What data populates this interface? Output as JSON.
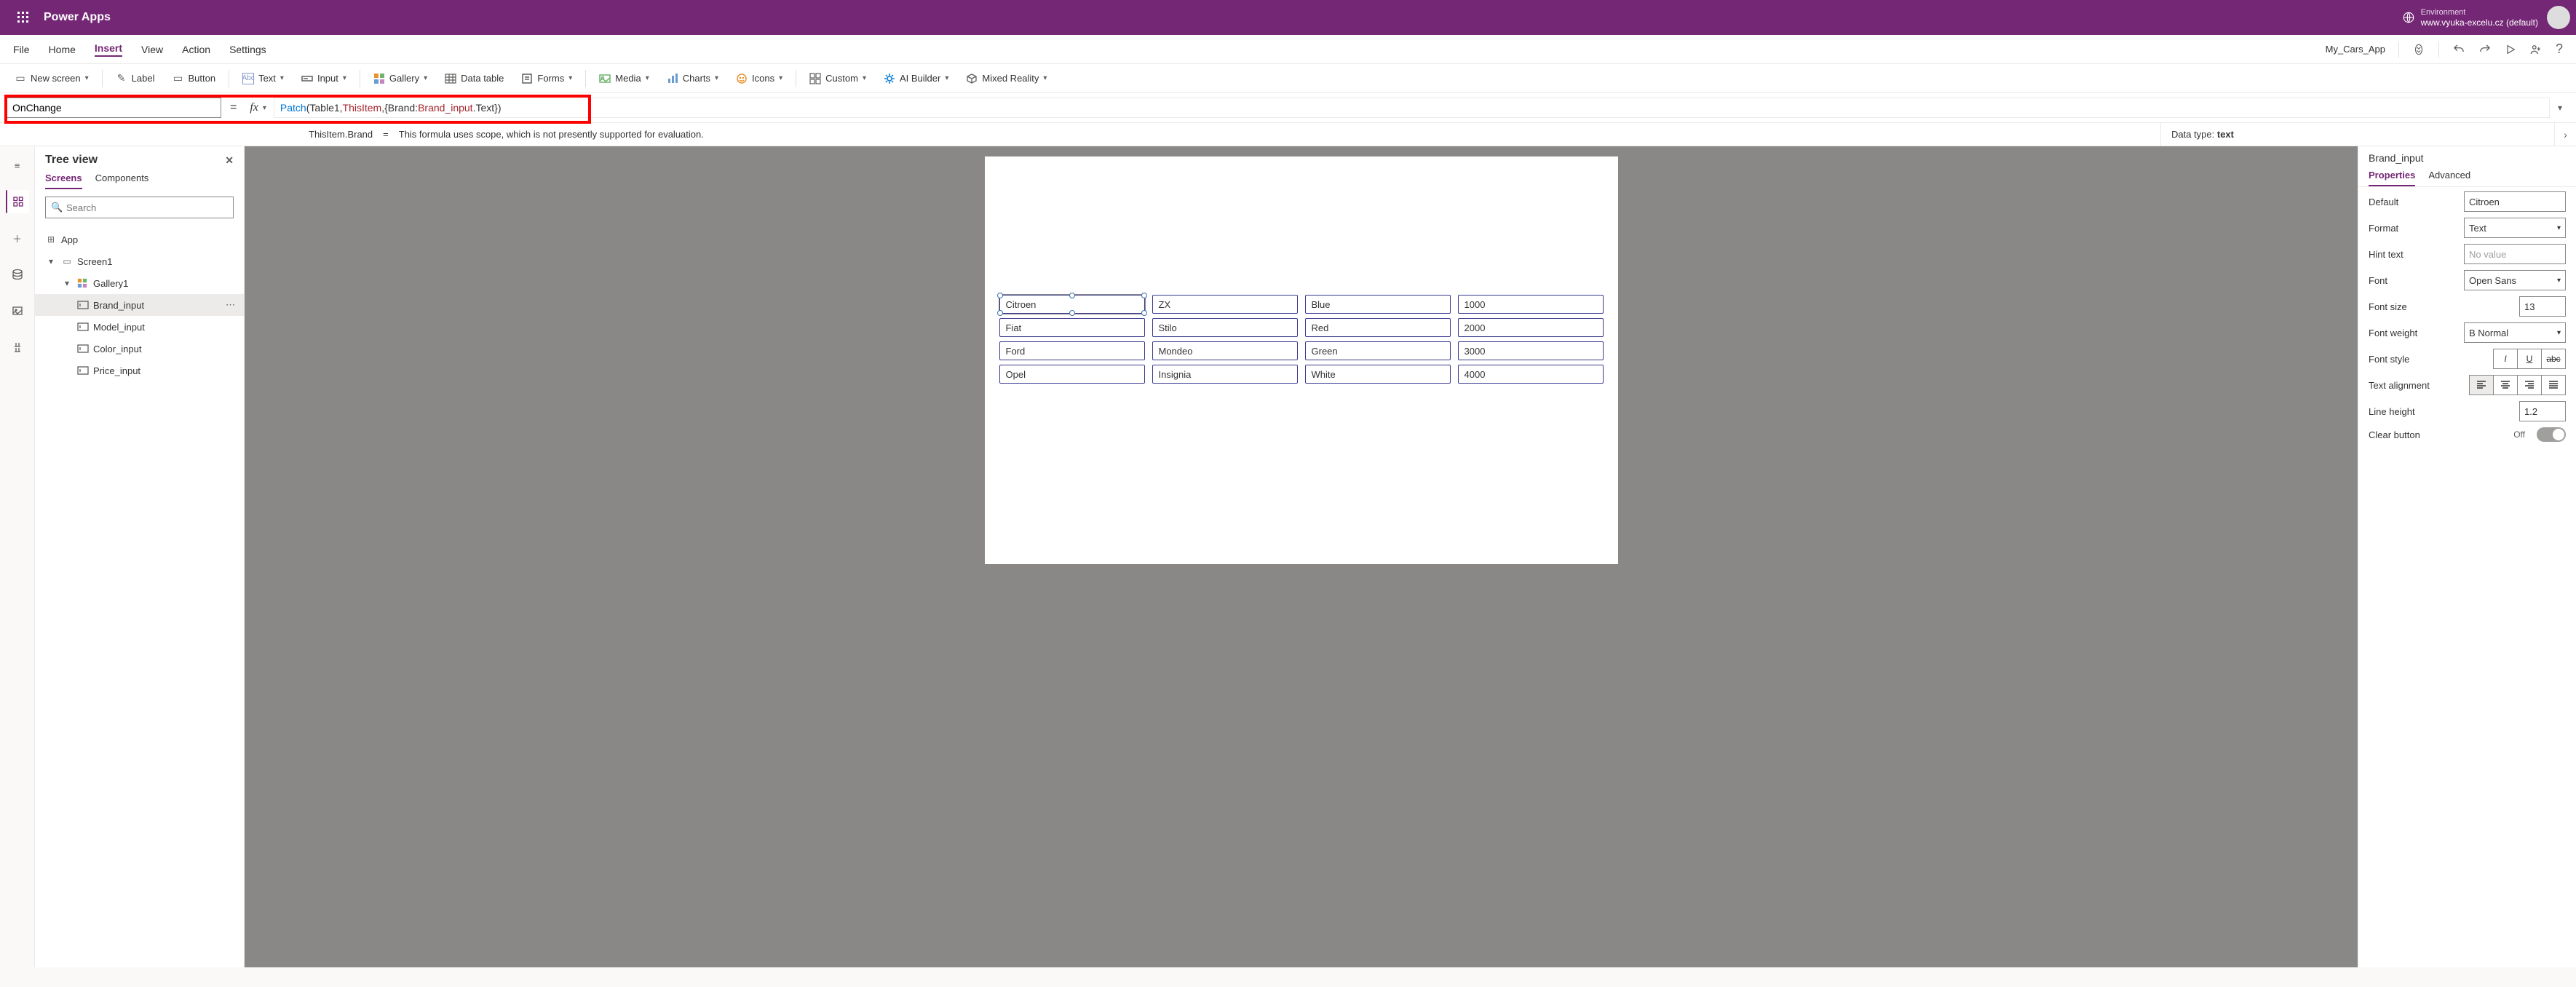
{
  "header": {
    "app_title": "Power Apps",
    "env_label": "Environment",
    "env_name": "www.vyuka-excelu.cz (default)"
  },
  "menu": {
    "items": [
      "File",
      "Home",
      "Insert",
      "View",
      "Action",
      "Settings"
    ],
    "active_index": 2,
    "app_name": "My_Cars_App"
  },
  "ribbon": {
    "new_screen": "New screen",
    "label": "Label",
    "button": "Button",
    "text": "Text",
    "input": "Input",
    "gallery": "Gallery",
    "data_table": "Data table",
    "forms": "Forms",
    "media": "Media",
    "charts": "Charts",
    "icons": "Icons",
    "custom": "Custom",
    "ai_builder": "AI Builder",
    "mixed_reality": "Mixed Reality"
  },
  "formula_bar": {
    "property": "OnChange",
    "tokens": {
      "fn": "Patch",
      "t1": "(Table1,",
      "var1": "ThisItem",
      "t2": ",{Brand:",
      "var2": "Brand_input",
      "t3": ".Text})"
    }
  },
  "formula_info": {
    "left_label": "ThisItem.Brand",
    "eq": "=",
    "left_desc": "This formula uses scope, which is not presently supported for evaluation.",
    "right_label": "Data type: ",
    "right_value": "text"
  },
  "tree": {
    "title": "Tree view",
    "tabs": [
      "Screens",
      "Components"
    ],
    "active_tab": 0,
    "search_placeholder": "Search",
    "items": [
      {
        "label": "App",
        "indent": 0,
        "icon": "app"
      },
      {
        "label": "Screen1",
        "indent": 0,
        "icon": "screen",
        "caret": true
      },
      {
        "label": "Gallery1",
        "indent": 1,
        "icon": "gallery",
        "caret": true
      },
      {
        "label": "Brand_input",
        "indent": 2,
        "icon": "input",
        "selected": true
      },
      {
        "label": "Model_input",
        "indent": 2,
        "icon": "input"
      },
      {
        "label": "Color_input",
        "indent": 2,
        "icon": "input"
      },
      {
        "label": "Price_input",
        "indent": 2,
        "icon": "input"
      }
    ]
  },
  "gallery_data": {
    "rows": [
      [
        "Citroen",
        "ZX",
        "Blue",
        "1000"
      ],
      [
        "Fiat",
        "Stilo",
        "Red",
        "2000"
      ],
      [
        "Ford",
        "Mondeo",
        "Green",
        "3000"
      ],
      [
        "Opel",
        "Insignia",
        "White",
        "4000"
      ]
    ],
    "selected": [
      0,
      0
    ]
  },
  "props": {
    "selected_name": "Brand_input",
    "tabs": [
      "Properties",
      "Advanced"
    ],
    "active_tab": 0,
    "rows": {
      "default_l": "Default",
      "default_v": "Citroen",
      "format_l": "Format",
      "format_v": "Text",
      "hint_l": "Hint text",
      "hint_v": "No value",
      "font_l": "Font",
      "font_v": "Open Sans",
      "fsize_l": "Font size",
      "fsize_v": "13",
      "fweight_l": "Font weight",
      "fweight_v": "B  Normal",
      "fstyle_l": "Font style",
      "talign_l": "Text alignment",
      "lheight_l": "Line height",
      "lheight_v": "1.2",
      "clear_l": "Clear button",
      "clear_v": "Off"
    }
  }
}
